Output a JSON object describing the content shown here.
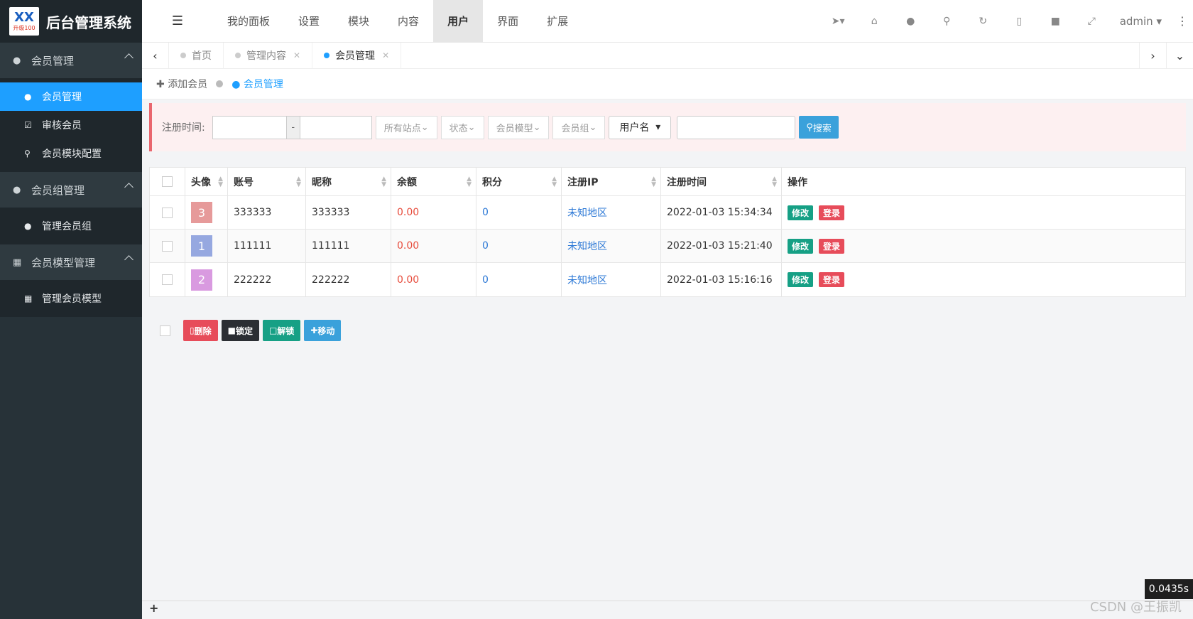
{
  "logo": {
    "mark": "XX",
    "mark_sub": "升级100",
    "title": "后台管理系统"
  },
  "sidebar": {
    "groups": [
      {
        "label": "会员管理",
        "icon": "user-icon",
        "items": [
          {
            "label": "会员管理",
            "icon": "user-icon",
            "active": true
          },
          {
            "label": "审核会员",
            "icon": "check-square-icon"
          },
          {
            "label": "会员模块配置",
            "icon": "search-icon"
          }
        ]
      },
      {
        "label": "会员组管理",
        "icon": "users-icon",
        "items": [
          {
            "label": "管理会员组",
            "icon": "users-icon"
          }
        ]
      },
      {
        "label": "会员模型管理",
        "icon": "grid-icon",
        "items": [
          {
            "label": "管理会员模型",
            "icon": "grid-icon"
          }
        ]
      }
    ]
  },
  "header": {
    "nav": [
      "我的面板",
      "设置",
      "模块",
      "内容",
      "用户",
      "界面",
      "扩展"
    ],
    "active_nav": "用户",
    "admin": "admin"
  },
  "tabs": [
    {
      "label": "首页",
      "closable": false
    },
    {
      "label": "管理内容",
      "closable": true
    },
    {
      "label": "会员管理",
      "closable": true,
      "active": true
    }
  ],
  "subbar": {
    "add": "添加会员",
    "current": "会员管理"
  },
  "filter": {
    "label": "注册时间:",
    "dash": "-",
    "sites": "所有站点",
    "status": "状态",
    "model": "会员模型",
    "group": "会员组",
    "field": "用户名",
    "search": "搜索"
  },
  "table": {
    "headers": [
      "头像",
      "账号",
      "昵称",
      "余额",
      "积分",
      "注册IP",
      "注册时间",
      "操作"
    ],
    "rows": [
      {
        "avatar": "3",
        "avatar_color": "#e69a9a",
        "account": "333333",
        "nickname": "333333",
        "balance": "0.00",
        "points": "0",
        "ip": "未知地区",
        "time": "2022-01-03 15:34:34"
      },
      {
        "avatar": "1",
        "avatar_color": "#96a8e0",
        "account": "111111",
        "nickname": "111111",
        "balance": "0.00",
        "points": "0",
        "ip": "未知地区",
        "time": "2022-01-03 15:21:40"
      },
      {
        "avatar": "2",
        "avatar_color": "#d99ae0",
        "account": "222222",
        "nickname": "222222",
        "balance": "0.00",
        "points": "0",
        "ip": "未知地区",
        "time": "2022-01-03 15:16:16"
      }
    ],
    "actions": {
      "edit": "修改",
      "login": "登录"
    }
  },
  "bulk": {
    "delete": "删除",
    "lock": "锁定",
    "unlock": "解锁",
    "move": "移动"
  },
  "footer": {
    "plus": "+"
  },
  "timer": "0.0435s",
  "watermark": "CSDN @王振凯"
}
